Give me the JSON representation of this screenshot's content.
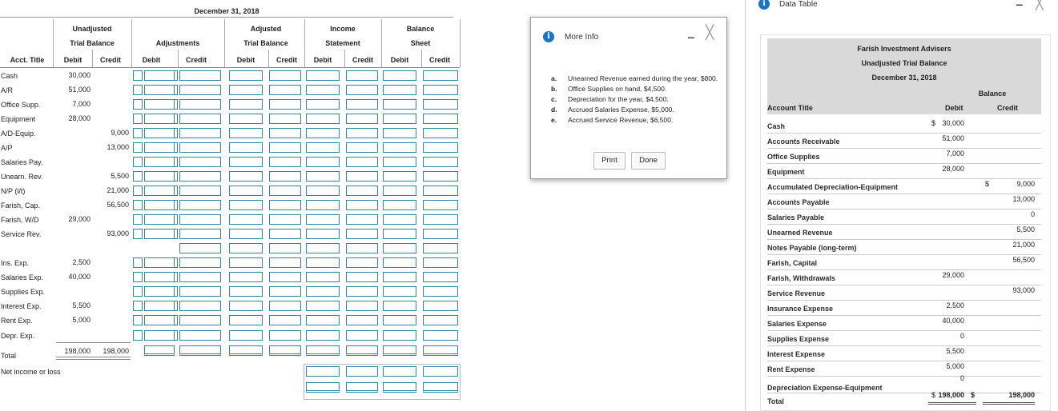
{
  "worksheet": {
    "date": "December 31, 2018",
    "headers": {
      "unadjusted_1": "Unadjusted",
      "unadjusted_2": "Trial Balance",
      "adjustments": "Adjustments",
      "adjusted_1": "Adjusted",
      "adjusted_2": "Trial Balance",
      "income_1": "Income",
      "income_2": "Statement",
      "balance_1": "Balance",
      "balance_2": "Sheet",
      "acct_title": "Acct. Title",
      "debit": "Debit",
      "credit": "Credit"
    },
    "accounts": [
      {
        "name": "Cash",
        "debit": "30,000",
        "credit": ""
      },
      {
        "name": "A/R",
        "debit": "51,000",
        "credit": ""
      },
      {
        "name": "Office Supp.",
        "debit": "7,000",
        "credit": ""
      },
      {
        "name": "Equipment",
        "debit": "28,000",
        "credit": ""
      },
      {
        "name": "A/D-Equip.",
        "debit": "",
        "credit": "9,000"
      },
      {
        "name": "A/P",
        "debit": "",
        "credit": "13,000"
      },
      {
        "name": "Salaries Pay.",
        "debit": "",
        "credit": ""
      },
      {
        "name": "Unearn. Rev.",
        "debit": "",
        "credit": "5,500"
      },
      {
        "name": "N/P (l/t)",
        "debit": "",
        "credit": "21,000"
      },
      {
        "name": "Farish, Cap.",
        "debit": "",
        "credit": "56,500"
      },
      {
        "name": "Farish, W/D",
        "debit": "29,000",
        "credit": ""
      },
      {
        "name": "Service Rev.",
        "debit": "",
        "credit": "93,000"
      },
      {
        "name": "",
        "debit": "",
        "credit": ""
      },
      {
        "name": "Ins. Exp.",
        "debit": "2,500",
        "credit": ""
      },
      {
        "name": "Salaries Exp.",
        "debit": "40,000",
        "credit": ""
      },
      {
        "name": "Supplies Exp.",
        "debit": "",
        "credit": ""
      },
      {
        "name": "Interest Exp.",
        "debit": "5,500",
        "credit": ""
      },
      {
        "name": "Rent Exp.",
        "debit": "5,000",
        "credit": ""
      },
      {
        "name": "Depr. Exp.",
        "debit": "",
        "credit": ""
      }
    ],
    "total_label": "Total",
    "total_debit": "198,000",
    "total_credit": "198,000",
    "net_income_label": "Net income or loss"
  },
  "more_info": {
    "title": "More Info",
    "items": [
      {
        "letter": "a.",
        "text": "Unearned Revenue earned during the year, $800."
      },
      {
        "letter": "b.",
        "text": "Office Supplies on hand, $4,500."
      },
      {
        "letter": "c.",
        "text": "Depreciation for the year, $4,500."
      },
      {
        "letter": "d.",
        "text": "Accrued Salaries Expense, $5,000."
      },
      {
        "letter": "e.",
        "text": "Accrued Service Revenue, $6,500."
      }
    ],
    "print_label": "Print",
    "done_label": "Done",
    "minimize_glyph": "‒",
    "close_glyph": "╳"
  },
  "data_table": {
    "title": "Data Table",
    "company": "Farish Investment Advisers",
    "report": "Unadjusted Trial Balance",
    "date": "December 31, 2018",
    "balance_label": "Balance",
    "col_title": "Account Title",
    "col_debit": "Debit",
    "col_credit": "Credit",
    "rows": [
      {
        "title": "Cash",
        "debit": "30,000",
        "credit": "",
        "dsign": "$",
        "csign": ""
      },
      {
        "title": "Accounts Receivable",
        "debit": "51,000",
        "credit": "",
        "dsign": "",
        "csign": ""
      },
      {
        "title": "Office Supplies",
        "debit": "7,000",
        "credit": "",
        "dsign": "",
        "csign": ""
      },
      {
        "title": "Equipment",
        "debit": "28,000",
        "credit": "",
        "dsign": "",
        "csign": ""
      },
      {
        "title": "Accumulated Depreciation-Equipment",
        "debit": "",
        "credit": "9,000",
        "dsign": "",
        "csign": "$"
      },
      {
        "title": "Accounts Payable",
        "debit": "",
        "credit": "13,000",
        "dsign": "",
        "csign": ""
      },
      {
        "title": "Salaries Payable",
        "debit": "",
        "credit": "0",
        "dsign": "",
        "csign": ""
      },
      {
        "title": "Unearned Revenue",
        "debit": "",
        "credit": "5,500",
        "dsign": "",
        "csign": ""
      },
      {
        "title": "Notes Payable (long-term)",
        "debit": "",
        "credit": "21,000",
        "dsign": "",
        "csign": ""
      },
      {
        "title": "Farish, Capital",
        "debit": "",
        "credit": "56,500",
        "dsign": "",
        "csign": ""
      },
      {
        "title": "Farish, Withdrawals",
        "debit": "29,000",
        "credit": "",
        "dsign": "",
        "csign": ""
      },
      {
        "title": "Service Revenue",
        "debit": "",
        "credit": "93,000",
        "dsign": "",
        "csign": ""
      },
      {
        "title": "Insurance Expense",
        "debit": "2,500",
        "credit": "",
        "dsign": "",
        "csign": ""
      },
      {
        "title": "Salaries Expense",
        "debit": "40,000",
        "credit": "",
        "dsign": "",
        "csign": ""
      },
      {
        "title": "Supplies Expense",
        "debit": "0",
        "credit": "",
        "dsign": "",
        "csign": ""
      },
      {
        "title": "Interest Expense",
        "debit": "5,500",
        "credit": "",
        "dsign": "",
        "csign": ""
      },
      {
        "title": "Rent Expense",
        "debit": "5,000",
        "credit": "",
        "dsign": "",
        "csign": ""
      },
      {
        "title": "Depreciation Expense-Equipment",
        "debit": "0",
        "credit": "",
        "dsign": "",
        "csign": ""
      }
    ],
    "total_label": "Total",
    "total_debit": "198,000",
    "total_credit": "198,000",
    "total_dsign": "$",
    "total_csign": "$",
    "minimize_glyph": "‒",
    "close_glyph": "╳"
  },
  "colors": {
    "accent": "#1a73c7",
    "input_border": "#2a8aa6",
    "table_header_bg": "#d9d9d9"
  }
}
